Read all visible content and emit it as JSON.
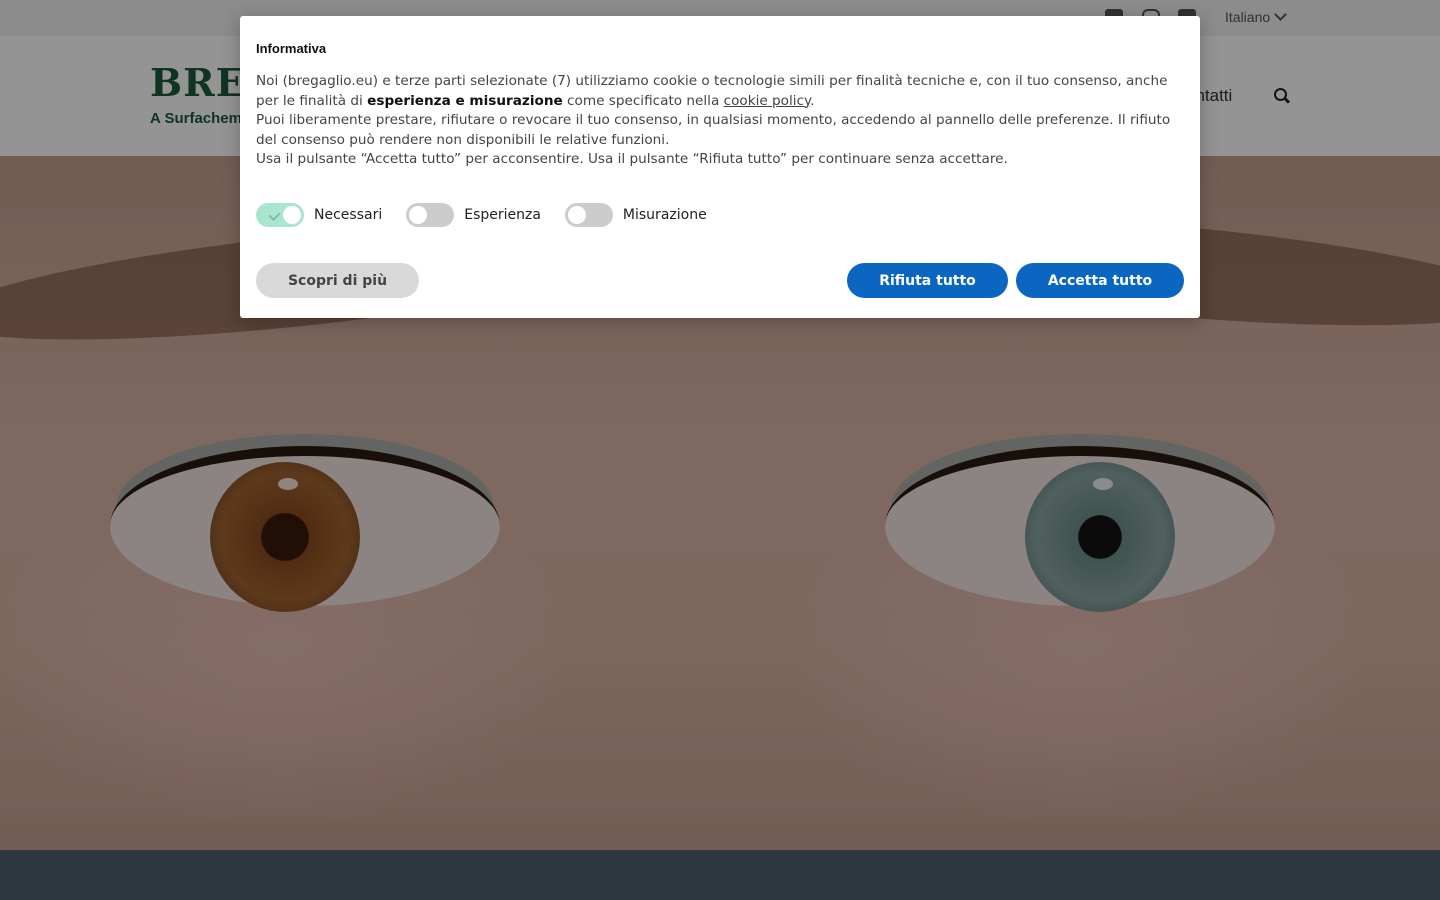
{
  "topbar": {
    "social": [
      "youtube-icon",
      "instagram-icon",
      "linkedin-icon"
    ],
    "language": "Italiano"
  },
  "header": {
    "logo": "BREG",
    "tagline": "A Surfachem",
    "nav_contatti": "ontatti"
  },
  "cookie": {
    "title": "Informativa",
    "p1_a": "Noi (bregaglio.eu) e terze parti selezionate (7) utilizziamo cookie o tecnologie simili per finalità tecniche e, con il tuo consenso, anche per le finalità di ",
    "p1_bold": "esperienza e misurazione",
    "p1_b": " come specificato nella ",
    "p1_link": "cookie policy",
    "p1_c": ".",
    "p2": "Puoi liberamente prestare, rifiutare o revocare il tuo consenso, in qualsiasi momento, accedendo al pannello delle preferenze. Il rifiuto del consenso può rendere non disponibili le relative funzioni.",
    "p3": "Usa il pulsante “Accetta tutto” per acconsentire. Usa il pulsante “Rifiuta tutto” per continuare senza accettare.",
    "toggles": [
      {
        "label": "Necessari",
        "on": true
      },
      {
        "label": "Esperienza",
        "on": false
      },
      {
        "label": "Misurazione",
        "on": false
      }
    ],
    "btn_more": "Scopri di più",
    "btn_reject": "Rifiuta tutto",
    "btn_accept": "Accetta tutto"
  },
  "colors": {
    "brand_green": "#1d5a3c",
    "button_blue": "#0b66c2",
    "toggle_on": "#a8e6cf",
    "footer_band": "#2c3740"
  }
}
